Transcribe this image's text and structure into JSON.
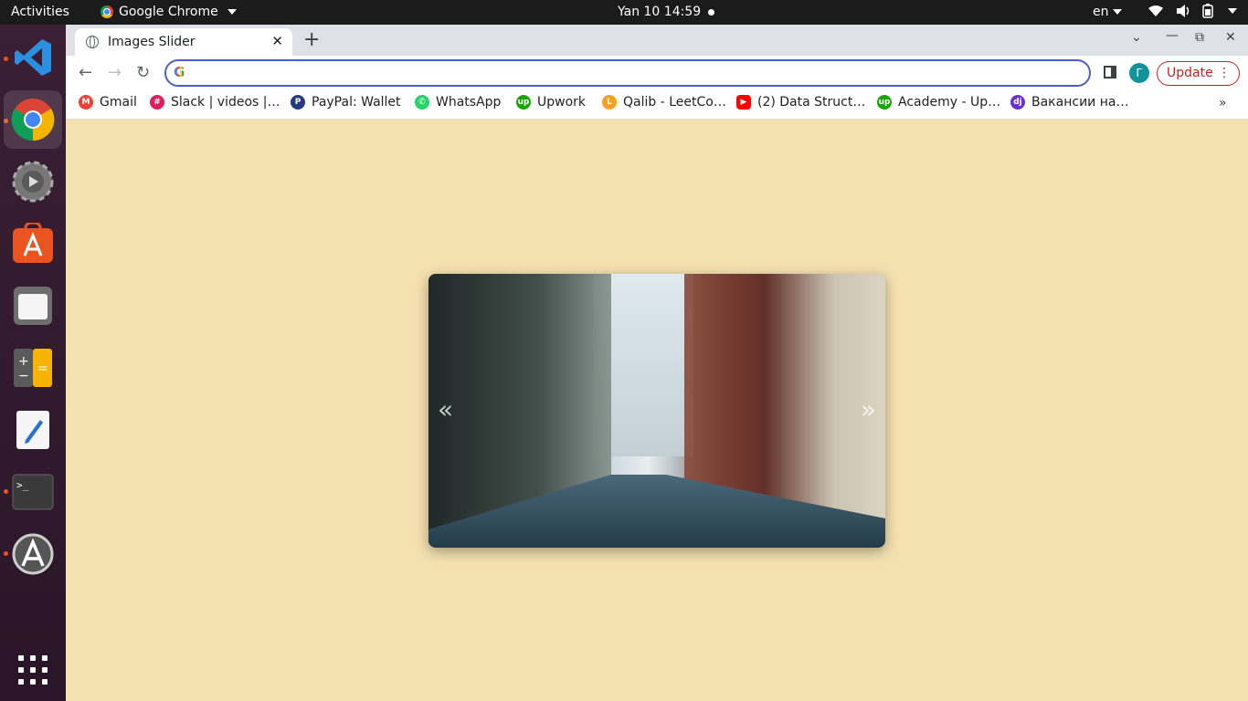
{
  "topbar": {
    "activities": "Activities",
    "app_name": "Google Chrome",
    "clock": "Yan 10  14:59",
    "lang": "en"
  },
  "dock": {
    "items": [
      "vscode",
      "chrome",
      "settings",
      "app-center",
      "files",
      "calculator",
      "text-editor",
      "terminal",
      "software-updater",
      "show-apps"
    ]
  },
  "browser": {
    "tab_title": "Images Slider",
    "omnibox_value": "",
    "avatar_letter": "Г",
    "update_label": "Update",
    "bookmarks": [
      {
        "label": "Gmail",
        "color": "#ea4335",
        "glyph": "M"
      },
      {
        "label": "Slack | videos |…",
        "color": "#e01e5a",
        "glyph": "#"
      },
      {
        "label": "PayPal: Wallet",
        "color": "#253b80",
        "glyph": "P"
      },
      {
        "label": "WhatsApp",
        "color": "#25d366",
        "glyph": "✆"
      },
      {
        "label": "Upwork",
        "color": "#14a800",
        "glyph": "up"
      },
      {
        "label": "Qalib - LeetCo…",
        "color": "#f89f1b",
        "glyph": "L"
      },
      {
        "label": "(2) Data Struct…",
        "color": "#ff0000",
        "glyph": "▶"
      },
      {
        "label": "Academy - Up…",
        "color": "#14a800",
        "glyph": "up"
      },
      {
        "label": "Вакансии на…",
        "color": "#6b2fd6",
        "glyph": "dj"
      }
    ]
  },
  "page": {
    "background": "#f4e1b1",
    "slider": {
      "prev_label": "«",
      "next_label": "»"
    }
  }
}
